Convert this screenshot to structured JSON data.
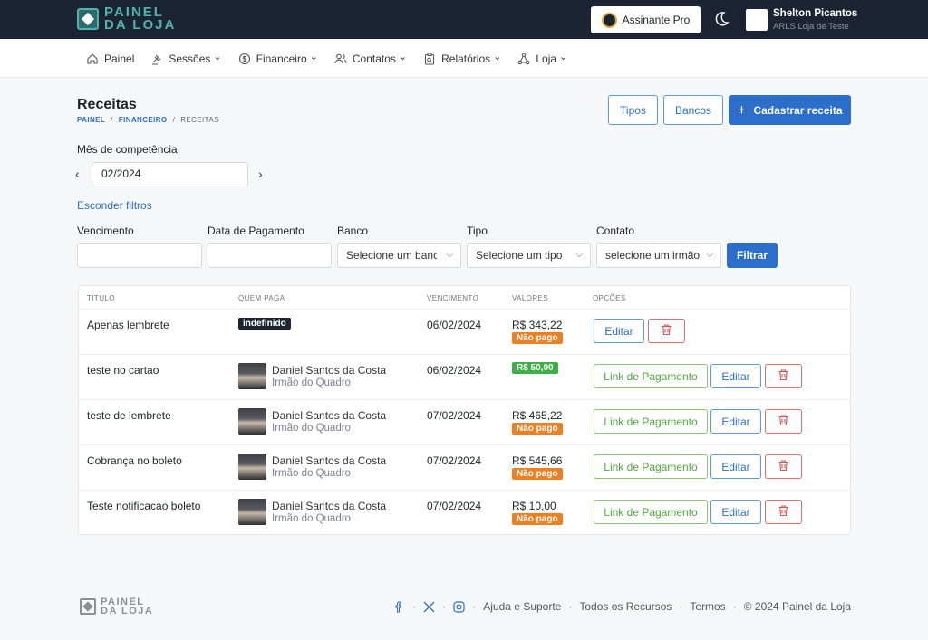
{
  "brand": {
    "line1": "PAINEL",
    "line2": "DA LOJA"
  },
  "topbar": {
    "pro_label": "Assinante Pro",
    "user_name": "Shelton Picantos",
    "user_org": "ARLS Loja de Teste"
  },
  "nav": {
    "items": [
      {
        "label": "Painel",
        "icon": "home-icon",
        "dropdown": false
      },
      {
        "label": "Sessões",
        "icon": "gavel-icon",
        "dropdown": true
      },
      {
        "label": "Financeiro",
        "icon": "dollar-icon",
        "dropdown": true
      },
      {
        "label": "Contatos",
        "icon": "users-icon",
        "dropdown": true
      },
      {
        "label": "Relatórios",
        "icon": "clipboard-icon",
        "dropdown": true
      },
      {
        "label": "Loja",
        "icon": "network-icon",
        "dropdown": true
      }
    ]
  },
  "page": {
    "title": "Receitas",
    "breadcrumb": [
      "PAINEL",
      "FINANCEIRO",
      "RECEITAS"
    ],
    "btn_tipos": "Tipos",
    "btn_bancos": "Bancos",
    "btn_cadastrar": "Cadastrar receita"
  },
  "period": {
    "label": "Mês de competência",
    "value": "02/2024"
  },
  "filters": {
    "toggle_label": "Esconder filtros",
    "vencimento_label": "Vencimento",
    "pagamento_label": "Data de Pagamento",
    "banco_label": "Banco",
    "banco_value": "Selecione um banco",
    "tipo_label": "Tipo",
    "tipo_value": "Selecione um tipo",
    "contato_label": "Contato",
    "contato_value": "selecione um irmão",
    "submit_label": "Filtrar"
  },
  "table": {
    "headers": [
      "TITULO",
      "QUEM PAGA",
      "VENCIMENTO",
      "VALORES",
      "OPÇÕES"
    ],
    "pay_link_label": "Link de Pagamento",
    "edit_label": "Editar",
    "rows": [
      {
        "title": "Apenas lembrete",
        "payer": null,
        "payer_badge": "indefinido",
        "due": "06/02/2024",
        "amount": "R$ 343,22",
        "status": "Não pago",
        "paid": false,
        "has_pay_link": false
      },
      {
        "title": "teste no cartao",
        "payer": "Daniel Santos da Costa",
        "payer_role": "Irmão do Quadro",
        "due": "06/02/2024",
        "amount": "R$ 50,00",
        "status": "",
        "paid": true,
        "has_pay_link": true
      },
      {
        "title": "teste de lembrete",
        "payer": "Daniel Santos da Costa",
        "payer_role": "Irmão do Quadro",
        "due": "07/02/2024",
        "amount": "R$ 465,22",
        "status": "Não pago",
        "paid": false,
        "has_pay_link": true
      },
      {
        "title": "Cobrança no boleto",
        "payer": "Daniel Santos da Costa",
        "payer_role": "Irmão do Quadro",
        "due": "07/02/2024",
        "amount": "R$ 545,66",
        "status": "Não pago",
        "paid": false,
        "has_pay_link": true
      },
      {
        "title": "Teste notificacao boleto",
        "payer": "Daniel Santos da Costa",
        "payer_role": "Irmão do Quadro",
        "due": "07/02/2024",
        "amount": "R$ 10,00",
        "status": "Não pago",
        "paid": false,
        "has_pay_link": true
      }
    ]
  },
  "footer": {
    "links": [
      "Ajuda e Suporte",
      "Todos os Recursos",
      "Termos"
    ],
    "copyright": "© 2024 Painel da Loja"
  }
}
